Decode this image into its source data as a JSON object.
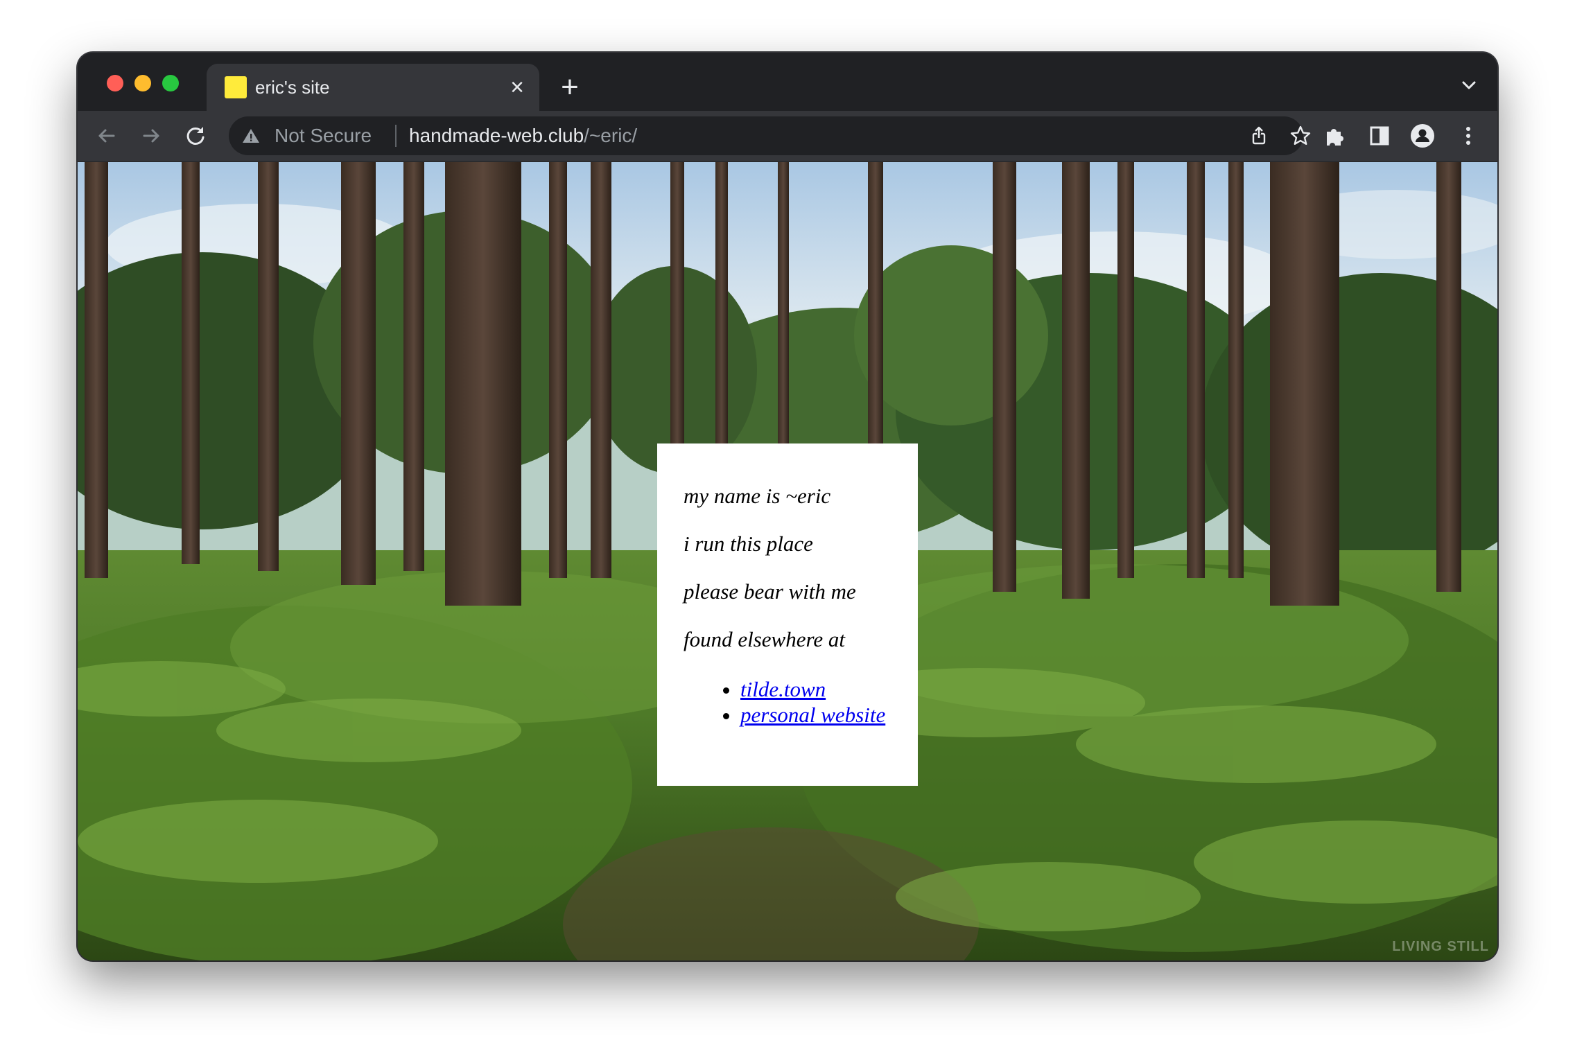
{
  "window": {
    "controls": [
      "close",
      "minimize",
      "zoom"
    ]
  },
  "tab": {
    "title": "eric's site",
    "favicon_color": "#ffeb3b",
    "close_icon": "close-icon",
    "new_tab_icon": "plus-icon"
  },
  "toolbar": {
    "back_icon": "back-arrow-icon",
    "forward_icon": "forward-arrow-icon",
    "reload_icon": "reload-icon",
    "security_label": "Not Secure",
    "url_host": "handmade-web.club",
    "url_path": "/~eric/",
    "right_icons": [
      "share-icon",
      "star-icon",
      "extensions-icon",
      "side-panel-icon",
      "profile-icon",
      "menu-icon"
    ]
  },
  "page": {
    "lines": [
      "my name is ~eric",
      "i run this place",
      "please bear with me",
      "found elsewhere at"
    ],
    "links": [
      "tilde.town",
      "personal website"
    ],
    "link_color": "#0000ee",
    "watermark": "LIVING STILL"
  },
  "colors": {
    "chrome_dark": "#202124",
    "chrome_tab": "#35363a",
    "text_light": "#e8eaed",
    "text_muted": "#9aa0a6"
  }
}
